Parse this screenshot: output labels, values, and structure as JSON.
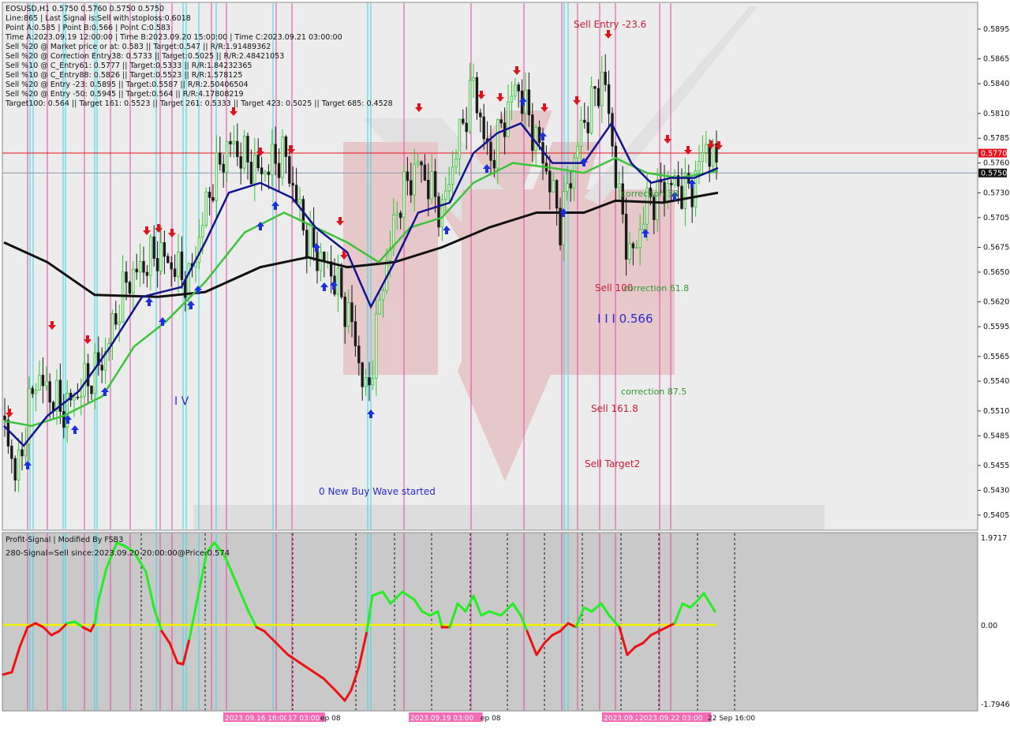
{
  "info_lines": [
    "EOSUSD,H1  0.5750 0.5760 0.5750 0.5750",
    "Line:865 | Last Signal is:Sell with stoploss:0.6018",
    "Point A:0.585 | Point B:0.566 | Point C:0.583",
    "Time A:2023.09.19 12:00:00 | Time B:2023.09.20 15:00:00 | Time C:2023.09.21 03:00:00",
    "Sell %20 @ Market price or at: 0.583 || Target:0.547 || R/R:1.91489362",
    "Sell %20 @ Correction Entry38: 0.5733 || Target:0.5025 || R/R:2.48421053",
    "Sell %10 @ C_Entry61: 0.5777 || Target:0.5333 || R/R:1.84232365",
    "Sell %10 @ C_Entry88: 0.5826 || Target:0.5523 || R/R:1.578125",
    "Sell %20 @ Entry -23: 0.5895 || Target:0.5587 || R/R:2.50406504",
    "Sell %20 @ Entry -50: 0.5945 || Target:0.564 || R/R:4.17808219",
    "Target100: 0.564 || Target 161: 0.5523 || Target 261: 0.5333 || Target 423: 0.5025 || Target 685: 0.4528"
  ],
  "price_axis": {
    "ticks": [
      "0.5895",
      "0.5865",
      "0.5840",
      "0.5810",
      "0.5785",
      "0.5760",
      "0.5730",
      "0.5705",
      "0.5675",
      "0.5650",
      "0.5620",
      "0.5595",
      "0.5565",
      "0.5540",
      "0.5510",
      "0.5485",
      "0.5455",
      "0.5430",
      "0.5405"
    ],
    "current_label": "0.5750",
    "signal_label": "0.5770"
  },
  "chart_data": {
    "type": "candlestick",
    "symbol": "EOSUSD",
    "timeframe": "H1",
    "ohlc": [
      0.575,
      0.576,
      0.575,
      0.575
    ],
    "ylim": [
      0.5393,
      0.5918
    ],
    "levels": {
      "bid": 0.575,
      "signal": 0.577
    },
    "point_a": 0.585,
    "point_b": 0.566,
    "point_c": 0.583
  },
  "annotations": {
    "sell_entry": "Sell Entry -23.6",
    "correction_38": "correction 38",
    "sell_100": "Sell 100",
    "correction_61": "correction 61.8",
    "wave_label": "I I I 0.566",
    "correction_87": "correction 87.5",
    "sell_161": "Sell 161.8",
    "sell_target2": "Sell Target2",
    "wave_iv": "I V",
    "new_buy_wave": "0 New Buy Wave started"
  },
  "indicator": {
    "title": "Profit-Signal | Modified By FSB3",
    "signal_text": "280-Signal=Sell since:2023.09.20 20:00:00@Price:0.574",
    "ticks": [
      "1.9717",
      "0.00",
      "-1.7946"
    ]
  },
  "time_axis": [
    {
      "label": "2023.09.16 16:00"
    },
    {
      "label": "17 03:00"
    },
    {
      "label": "ep 08"
    },
    {
      "label": "2023.09.19 03:00"
    },
    {
      "label": "ep 08"
    },
    {
      "label": "2023.09.21 16:0"
    },
    {
      "label": "2023.09.22 03:00"
    },
    {
      "label": "22 Sep 16:00"
    }
  ],
  "colors": {
    "bull_bar": "#2fc42f",
    "bear_bar": "#1a1a1a",
    "ma_fast": "#13138f",
    "ma_mid": "#3ac43a",
    "ma_slow": "#111111",
    "sell_arrow": "#e0131d",
    "buy_arrow": "#1b2fe0",
    "signal_line": "#e5141c",
    "osc_up": "#22ee22",
    "osc_down": "#ee1111",
    "zero_line": "#f0f000",
    "pink_line": "#e04aa0",
    "cyan_line": "#35d6e6",
    "watermark": "#d94c55"
  }
}
